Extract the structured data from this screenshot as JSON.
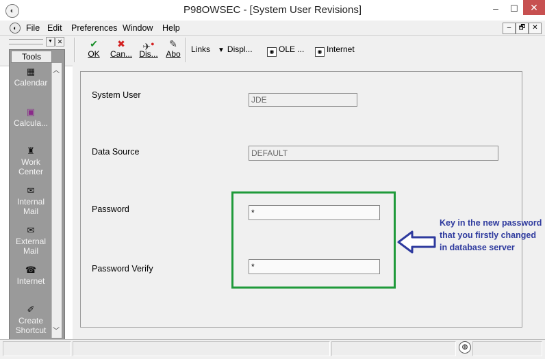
{
  "window": {
    "title": "P98OWSEC - [System User Revisions]",
    "minimize": "‒",
    "maximize": "☐",
    "close": "✕",
    "app_icon": "◐"
  },
  "menu": {
    "items": [
      "File",
      "Edit",
      "Preferences",
      "Window",
      "Help"
    ],
    "mdi_minimize": "–",
    "mdi_restore": "🗗",
    "mdi_close": "✕"
  },
  "toolbar": {
    "buttons": [
      {
        "label": "OK",
        "icon": "✔",
        "icon_color": "#1a8f2a"
      },
      {
        "label": "Can...",
        "icon": "✖",
        "icon_color": "#d32020"
      },
      {
        "label": "Dis...",
        "icon": "✈",
        "icon_color": "#333333"
      },
      {
        "label": "Abo",
        "icon": "✎",
        "icon_color": "#333333"
      }
    ],
    "links_label": "Links",
    "display_label": "Displ...",
    "ole_label": "OLE ...",
    "internet_label": "Internet"
  },
  "tools": {
    "header": "Tools",
    "items": [
      {
        "label": "Calendar",
        "icon": "▦"
      },
      {
        "label": "Calcula...",
        "icon": "▣"
      },
      {
        "label": "Work\nCenter",
        "icon": "♜"
      },
      {
        "label": "Internal\nMail",
        "icon": "✉"
      },
      {
        "label": "External\nMail",
        "icon": "✉"
      },
      {
        "label": "Internet",
        "icon": "☎"
      },
      {
        "label": "Create\nShortcut",
        "icon": "✐"
      }
    ]
  },
  "form": {
    "system_user_label": "System User",
    "system_user_value": "JDE",
    "data_source_label": "Data Source",
    "data_source_value": "DEFAULT",
    "password_label": "Password",
    "password_value": "*",
    "password_verify_label": "Password Verify",
    "password_verify_value": "*"
  },
  "annotation": {
    "text": "Key in the new password that you firstly changed in database server",
    "color": "#2e3a9e",
    "box_color": "#1f9a3a"
  }
}
